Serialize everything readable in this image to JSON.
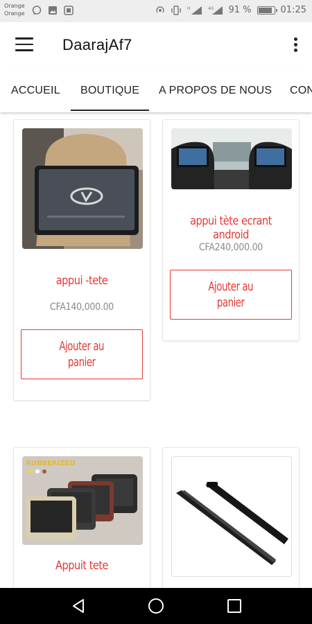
{
  "status_bar": {
    "carrier_line1": "Orange",
    "carrier_line2": "Orange",
    "battery_percent": "91 %",
    "battery_level": 0.91,
    "time": "01:25",
    "icons": [
      "chat-bubble-icon",
      "image-icon",
      "screenshot-icon",
      "hotspot-icon",
      "vibrate-icon",
      "signal-icon",
      "signal-icon",
      "battery-icon"
    ]
  },
  "app_bar": {
    "title": "DaarajAf7",
    "menu_icon": "hamburger-menu-icon",
    "overflow_icon": "more-vert-icon"
  },
  "tabs": [
    {
      "label": "ACCUEIL",
      "active": false
    },
    {
      "label": "BOUTIQUE",
      "active": true
    },
    {
      "label": "A PROPOS DE NOUS",
      "active": false
    },
    {
      "label": "CON",
      "active": false
    }
  ],
  "products": [
    {
      "name": "appui -tete",
      "price": "CFA140,000.00",
      "button": "Ajouter au panier",
      "button_line1": "Ajouter au",
      "button_line2": "panier",
      "image": "headrest-screen-photo"
    },
    {
      "name": "appui tète ecrant android",
      "price": "CFA240,000.00",
      "button": "Ajouter au panier",
      "button_line1": "Ajouter au",
      "button_line2": "panier",
      "image": "dual-headrest-screens-photo"
    },
    {
      "name": "Appuit tete",
      "price": "",
      "button": "",
      "image": "headrest-monitors-product-photo",
      "brand_text": "RUBBERIZED"
    },
    {
      "name": "",
      "price": "",
      "button": "",
      "image": "wiper-arm-photo"
    }
  ],
  "nav_bar": {
    "icons": [
      "back-triangle-icon",
      "home-circle-icon",
      "recents-square-icon"
    ]
  },
  "colors": {
    "accent": "#e53935",
    "status_bar_bg": "#eeeeee",
    "nav_bar_bg": "#000000",
    "price_text": "#888888"
  }
}
